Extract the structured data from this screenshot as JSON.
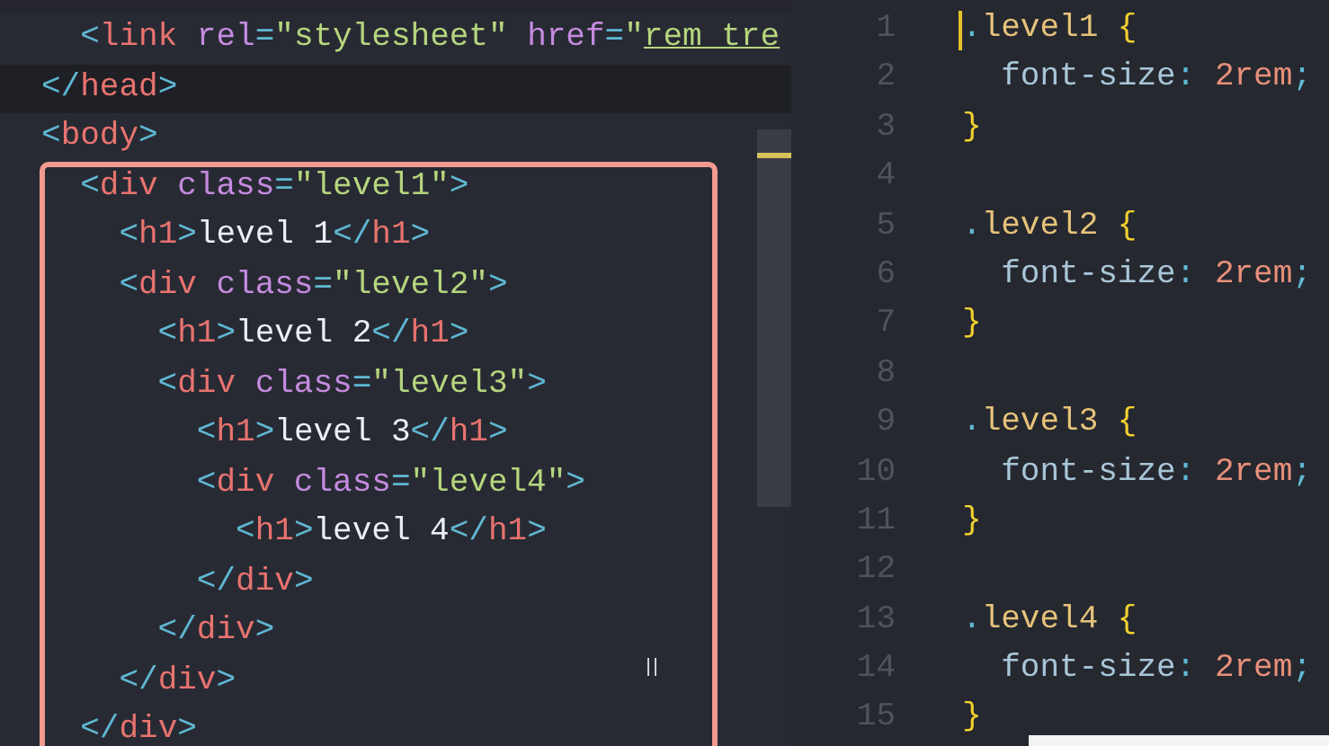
{
  "editors": [
    {
      "lines": [
        {
          "current": false,
          "tokens": [
            {
              "kind": "punct",
              "text": "  <"
            },
            {
              "kind": "tag",
              "text": "link"
            },
            {
              "kind": "attr",
              "text": " rel"
            },
            {
              "kind": "punct",
              "text": "="
            },
            {
              "kind": "string",
              "text": "\"stylesheet\""
            },
            {
              "kind": "attr",
              "text": " href"
            },
            {
              "kind": "punct",
              "text": "="
            },
            {
              "kind": "string",
              "text": "\""
            },
            {
              "kind": "link",
              "text": "rem_tre"
            }
          ]
        },
        {
          "current": true,
          "tokens": [
            {
              "kind": "punct",
              "text": "</"
            },
            {
              "kind": "tag",
              "text": "head"
            },
            {
              "kind": "punct",
              "text": ">"
            }
          ]
        },
        {
          "current": false,
          "tokens": [
            {
              "kind": "punct",
              "text": "<"
            },
            {
              "kind": "tag",
              "text": "body"
            },
            {
              "kind": "punct",
              "text": ">"
            }
          ]
        },
        {
          "current": false,
          "tokens": [
            {
              "kind": "punct",
              "text": "  <"
            },
            {
              "kind": "tag",
              "text": "div"
            },
            {
              "kind": "attr",
              "text": " class"
            },
            {
              "kind": "punct",
              "text": "="
            },
            {
              "kind": "string",
              "text": "\"level1\""
            },
            {
              "kind": "punct",
              "text": ">"
            }
          ]
        },
        {
          "current": false,
          "tokens": [
            {
              "kind": "punct",
              "text": "    <"
            },
            {
              "kind": "tag",
              "text": "h1"
            },
            {
              "kind": "punct",
              "text": ">"
            },
            {
              "kind": "text",
              "text": "level 1"
            },
            {
              "kind": "punct",
              "text": "</"
            },
            {
              "kind": "tag",
              "text": "h1"
            },
            {
              "kind": "punct",
              "text": ">"
            }
          ]
        },
        {
          "current": false,
          "tokens": [
            {
              "kind": "punct",
              "text": "    <"
            },
            {
              "kind": "tag",
              "text": "div"
            },
            {
              "kind": "attr",
              "text": " class"
            },
            {
              "kind": "punct",
              "text": "="
            },
            {
              "kind": "string",
              "text": "\"level2\""
            },
            {
              "kind": "punct",
              "text": ">"
            }
          ]
        },
        {
          "current": false,
          "tokens": [
            {
              "kind": "punct",
              "text": "      <"
            },
            {
              "kind": "tag",
              "text": "h1"
            },
            {
              "kind": "punct",
              "text": ">"
            },
            {
              "kind": "text",
              "text": "level 2"
            },
            {
              "kind": "punct",
              "text": "</"
            },
            {
              "kind": "tag",
              "text": "h1"
            },
            {
              "kind": "punct",
              "text": ">"
            }
          ]
        },
        {
          "current": false,
          "tokens": [
            {
              "kind": "punct",
              "text": "      <"
            },
            {
              "kind": "tag",
              "text": "div"
            },
            {
              "kind": "attr",
              "text": " class"
            },
            {
              "kind": "punct",
              "text": "="
            },
            {
              "kind": "string",
              "text": "\"level3\""
            },
            {
              "kind": "punct",
              "text": ">"
            }
          ]
        },
        {
          "current": false,
          "tokens": [
            {
              "kind": "punct",
              "text": "        <"
            },
            {
              "kind": "tag",
              "text": "h1"
            },
            {
              "kind": "punct",
              "text": ">"
            },
            {
              "kind": "text",
              "text": "level 3"
            },
            {
              "kind": "punct",
              "text": "</"
            },
            {
              "kind": "tag",
              "text": "h1"
            },
            {
              "kind": "punct",
              "text": ">"
            }
          ]
        },
        {
          "current": false,
          "tokens": [
            {
              "kind": "punct",
              "text": "        <"
            },
            {
              "kind": "tag",
              "text": "div"
            },
            {
              "kind": "attr",
              "text": " class"
            },
            {
              "kind": "punct",
              "text": "="
            },
            {
              "kind": "string",
              "text": "\"level4\""
            },
            {
              "kind": "punct",
              "text": ">"
            }
          ]
        },
        {
          "current": false,
          "tokens": [
            {
              "kind": "punct",
              "text": "          <"
            },
            {
              "kind": "tag",
              "text": "h1"
            },
            {
              "kind": "punct",
              "text": ">"
            },
            {
              "kind": "text",
              "text": "level 4"
            },
            {
              "kind": "punct",
              "text": "</"
            },
            {
              "kind": "tag",
              "text": "h1"
            },
            {
              "kind": "punct",
              "text": ">"
            }
          ]
        },
        {
          "current": false,
          "tokens": [
            {
              "kind": "punct",
              "text": "        </"
            },
            {
              "kind": "tag",
              "text": "div"
            },
            {
              "kind": "punct",
              "text": ">"
            }
          ]
        },
        {
          "current": false,
          "tokens": [
            {
              "kind": "punct",
              "text": "      </"
            },
            {
              "kind": "tag",
              "text": "div"
            },
            {
              "kind": "punct",
              "text": ">"
            }
          ]
        },
        {
          "current": false,
          "tokens": [
            {
              "kind": "punct",
              "text": "    </"
            },
            {
              "kind": "tag",
              "text": "div"
            },
            {
              "kind": "punct",
              "text": ">"
            }
          ]
        },
        {
          "current": false,
          "tokens": [
            {
              "kind": "punct",
              "text": "  </"
            },
            {
              "kind": "tag",
              "text": "div"
            },
            {
              "kind": "punct",
              "text": ">"
            }
          ]
        }
      ]
    },
    {
      "lines": [
        {
          "number": "1",
          "cursor": true,
          "tokens": [
            {
              "kind": "punct",
              "text": "."
            },
            {
              "kind": "selector",
              "text": "level1"
            },
            {
              "kind": "brace",
              "text": " {"
            }
          ]
        },
        {
          "number": "2",
          "cursor": false,
          "tokens": [
            {
              "kind": "property",
              "text": "  font-size"
            },
            {
              "kind": "punct",
              "text": ": "
            },
            {
              "kind": "value",
              "text": "2rem"
            },
            {
              "kind": "punct",
              "text": ";"
            }
          ]
        },
        {
          "number": "3",
          "cursor": false,
          "tokens": [
            {
              "kind": "brace",
              "text": "}"
            }
          ]
        },
        {
          "number": "4",
          "cursor": false
        },
        {
          "number": "5",
          "cursor": false,
          "tokens": [
            {
              "kind": "punct",
              "text": "."
            },
            {
              "kind": "selector",
              "text": "level2"
            },
            {
              "kind": "brace",
              "text": " {"
            }
          ]
        },
        {
          "number": "6",
          "cursor": false,
          "tokens": [
            {
              "kind": "property",
              "text": "  font-size"
            },
            {
              "kind": "punct",
              "text": ": "
            },
            {
              "kind": "value",
              "text": "2rem"
            },
            {
              "kind": "punct",
              "text": ";"
            }
          ]
        },
        {
          "number": "7",
          "cursor": false,
          "tokens": [
            {
              "kind": "brace",
              "text": "}"
            }
          ]
        },
        {
          "number": "8",
          "cursor": false
        },
        {
          "number": "9",
          "cursor": false,
          "tokens": [
            {
              "kind": "punct",
              "text": "."
            },
            {
              "kind": "selector",
              "text": "level3"
            },
            {
              "kind": "brace",
              "text": " {"
            }
          ]
        },
        {
          "number": "10",
          "cursor": false,
          "tokens": [
            {
              "kind": "property",
              "text": "  font-size"
            },
            {
              "kind": "punct",
              "text": ": "
            },
            {
              "kind": "value",
              "text": "2rem"
            },
            {
              "kind": "punct",
              "text": ";"
            }
          ]
        },
        {
          "number": "11",
          "cursor": false,
          "tokens": [
            {
              "kind": "brace",
              "text": "}"
            }
          ]
        },
        {
          "number": "12",
          "cursor": false
        },
        {
          "number": "13",
          "cursor": false,
          "tokens": [
            {
              "kind": "punct",
              "text": "."
            },
            {
              "kind": "selector",
              "text": "level4"
            },
            {
              "kind": "brace",
              "text": " {"
            }
          ]
        },
        {
          "number": "14",
          "cursor": false,
          "tokens": [
            {
              "kind": "property",
              "text": "  font-size"
            },
            {
              "kind": "punct",
              "text": ": "
            },
            {
              "kind": "value",
              "text": "2rem"
            },
            {
              "kind": "punct",
              "text": ";"
            }
          ]
        },
        {
          "number": "15",
          "cursor": false,
          "tokens": [
            {
              "kind": "brace",
              "text": "}"
            }
          ]
        }
      ]
    }
  ]
}
